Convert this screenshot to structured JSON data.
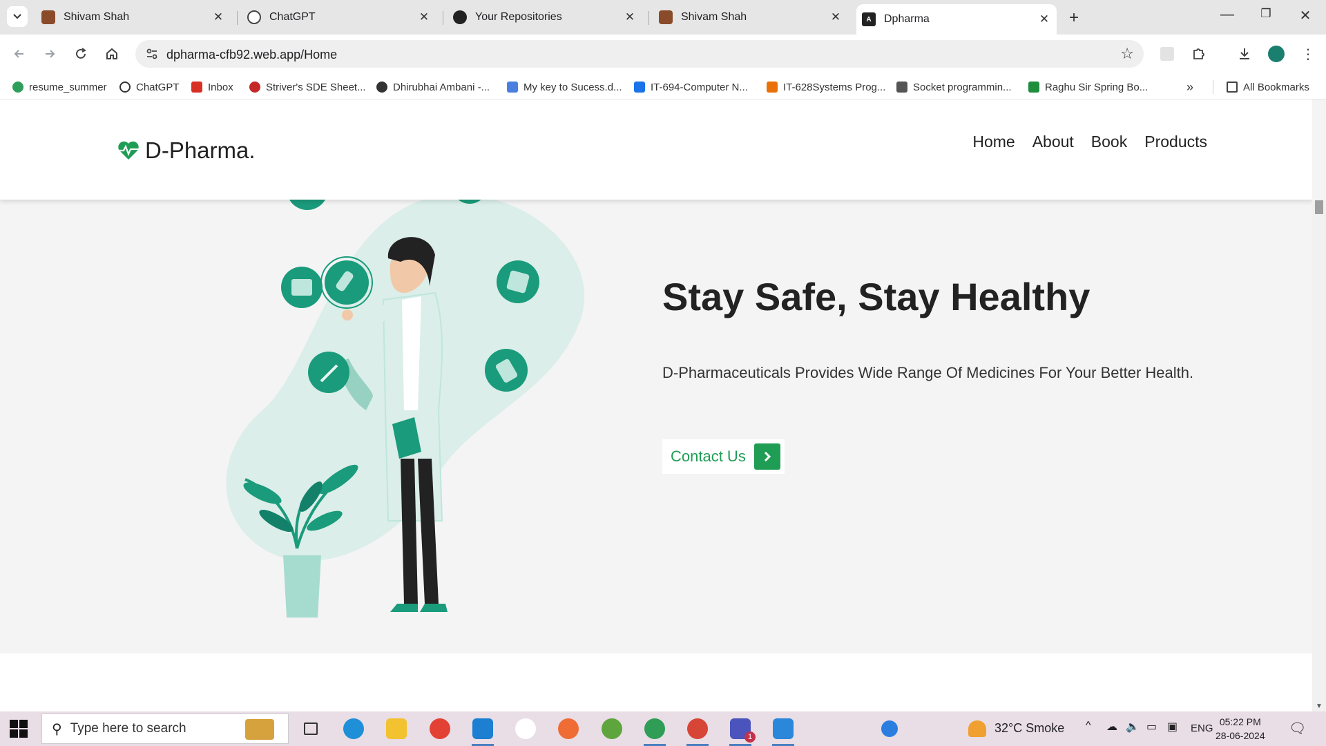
{
  "browser": {
    "tabs": [
      {
        "title": "Shivam Shah",
        "favicon": "profile-photo-icon",
        "active": false
      },
      {
        "title": "ChatGPT",
        "favicon": "chatgpt-icon",
        "active": false
      },
      {
        "title": "Your Repositories",
        "favicon": "github-icon",
        "active": false
      },
      {
        "title": "Shivam Shah",
        "favicon": "profile-photo-icon",
        "active": false
      },
      {
        "title": "Dpharma",
        "favicon": "angular-icon",
        "active": true
      }
    ],
    "url": "dpharma-cfb92.web.app/Home",
    "bookmarks": [
      {
        "label": "resume_summer",
        "color": "#2e9e5b"
      },
      {
        "label": "ChatGPT",
        "color": "#333333"
      },
      {
        "label": "Inbox",
        "color": "#d93025"
      },
      {
        "label": "Striver's SDE Sheet...",
        "color": "#c62828"
      },
      {
        "label": "Dhirubhai Ambani -...",
        "color": "#333333"
      },
      {
        "label": "My key to Sucess.d...",
        "color": "#4a7fe0"
      },
      {
        "label": "IT-694-Computer N...",
        "color": "#1a73e8"
      },
      {
        "label": "IT-628Systems Prog...",
        "color": "#e8710a"
      },
      {
        "label": "Socket programmin...",
        "color": "#555555"
      },
      {
        "label": "Raghu Sir Spring Bo...",
        "color": "#1e8e3e"
      }
    ],
    "all_bookmarks": "All Bookmarks"
  },
  "site": {
    "logo_text": "D-Pharma.",
    "nav": [
      "Home",
      "About",
      "Book",
      "Products"
    ],
    "hero": {
      "title": "Stay Safe, Stay Healthy",
      "description": "D-Pharmaceuticals Provides Wide Range Of Medicines For Your Better Health.",
      "cta_label": "Contact Us"
    },
    "accent_color": "#1f9d55",
    "teal_color": "#1a9b7b"
  },
  "taskbar": {
    "search_placeholder": "Type here to search",
    "weather": "32°C  Smoke",
    "language": "ENG",
    "time": "05:22 PM",
    "date": "28-06-2024",
    "teams_badge": "1"
  }
}
